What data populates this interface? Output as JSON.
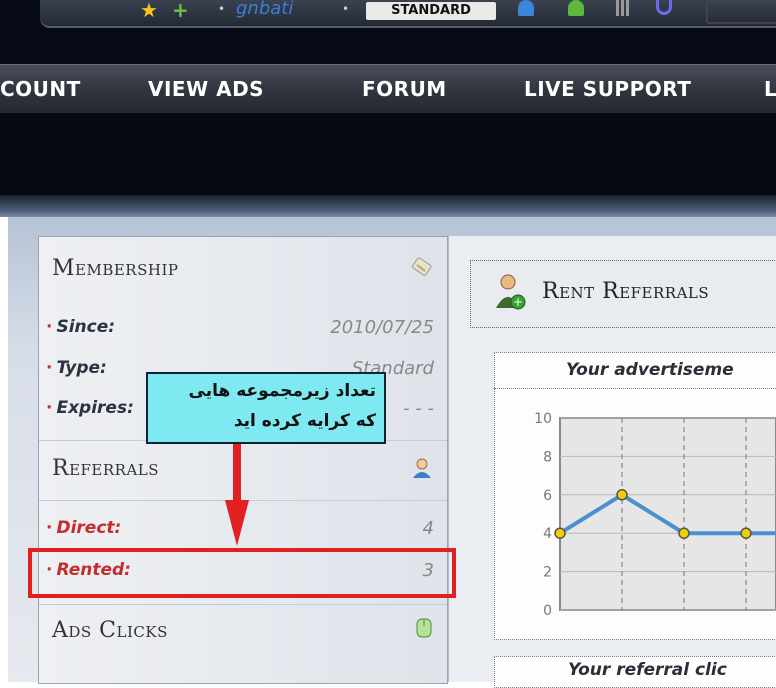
{
  "topbar": {
    "username": "gnbati",
    "membership_badge": "STANDARD"
  },
  "nav": {
    "items": [
      "COUNT",
      "VIEW ADS",
      "FORUM",
      "LIVE SUPPORT",
      "L"
    ]
  },
  "sidebar": {
    "membership": {
      "title": "Membership",
      "rows": [
        {
          "label": "Since:",
          "value": "2010/07/25"
        },
        {
          "label": "Type:",
          "value": "Standard"
        },
        {
          "label": "Expires:",
          "value": "- - -"
        }
      ]
    },
    "referrals": {
      "title": "Referrals",
      "rows": [
        {
          "label": "Direct:",
          "value": "4"
        },
        {
          "label": "Rented:",
          "value": "3"
        }
      ]
    },
    "ads_clicks": {
      "title": "Ads Clicks"
    }
  },
  "annotation": {
    "line1": "تعداد زیرمجموعه هایی",
    "line2": "که کرایه کرده اید"
  },
  "right": {
    "rent_title": "Rent Referrals",
    "chart1_title": "Your advertiseme",
    "chart2_title": "Your referral clic"
  },
  "chart_data": {
    "type": "line",
    "title": "Your advertiseme",
    "yticks": [
      "0",
      "2",
      "4",
      "6",
      "8",
      "10"
    ],
    "ylim": [
      0,
      10
    ],
    "series": [
      {
        "values": [
          4,
          6,
          4,
          4,
          4
        ]
      }
    ],
    "grid": true
  },
  "colors": {
    "highlight": "#e0211f",
    "tooltip_bg": "#7fe9f2",
    "line": "#4a8fd0",
    "point": "#f0d000"
  }
}
